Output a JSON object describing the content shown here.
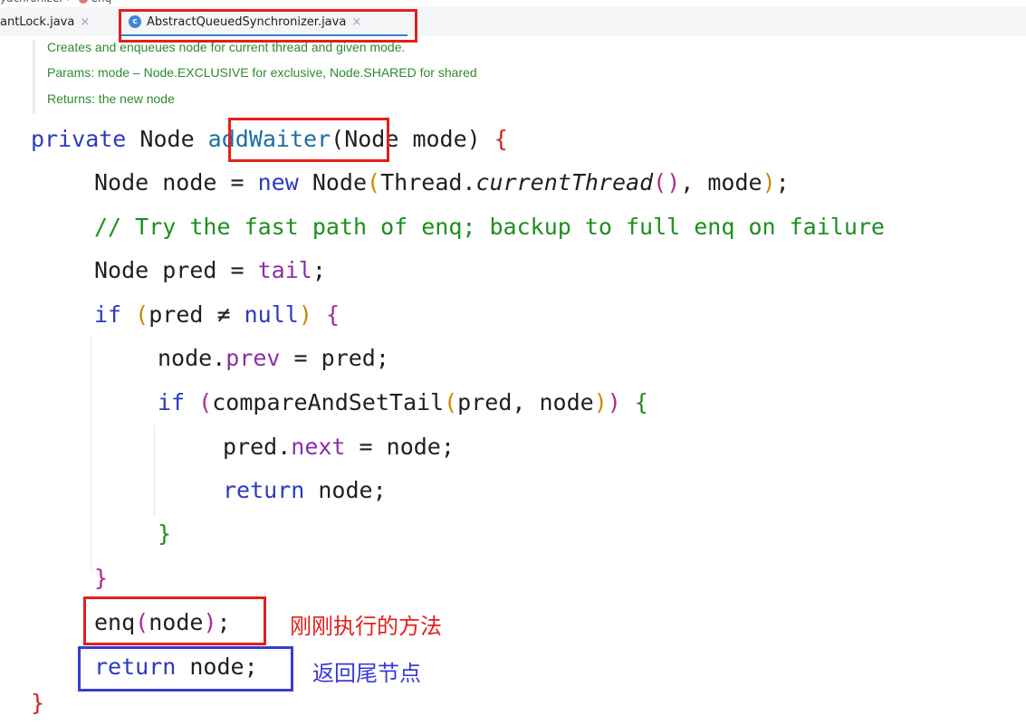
{
  "editor": {
    "tabs": [
      {
        "label": "antLock.java",
        "close": "×",
        "active": false
      },
      {
        "label": "AbstractQueuedSynchronizer.java",
        "close": "×",
        "active": true,
        "icon": "c-class-icon"
      }
    ]
  },
  "doc": {
    "line1": "Creates and enqueues node for current thread and given mode.",
    "line2": "Params: mode – Node.EXCLUSIVE for exclusive, Node.SHARED for shared",
    "line3": "Returns: the new node"
  },
  "code": {
    "l1": {
      "kw": "private",
      "t1": " Node ",
      "method": "addWaiter",
      "t2": "(Node mode) ",
      "brace": "{"
    },
    "l2": {
      "t1": "Node node = ",
      "kw": "new",
      "t2": " Node",
      "p1": "(",
      "t3": "Thread.",
      "it": "currentThread",
      "p2": "()",
      "t4": ", mode",
      "p3": ")",
      "t5": ";"
    },
    "l3": {
      "comment": "// Try the fast path of enq; backup to full enq on failure"
    },
    "l4": {
      "t1": "Node pred = ",
      "fld": "tail",
      "t2": ";"
    },
    "l5": {
      "kw": "if",
      "t1": " ",
      "p1": "(",
      "t2": "pred ≠ ",
      "kw2": "null",
      "p2": ")",
      "t3": " ",
      "brace": "{"
    },
    "l6": {
      "t1": "node.",
      "fld": "prev",
      "t2": " = pred;"
    },
    "l7": {
      "kw": "if",
      "t1": " ",
      "p1": "(",
      "t2": "compareAndSetTail",
      "p2": "(",
      "t3": "pred, node",
      "p3": ")",
      "p4": ")",
      "t4": " ",
      "brace": "{"
    },
    "l8": {
      "t1": "pred.",
      "fld": "next",
      "t2": " = node;"
    },
    "l9": {
      "kw": "return",
      "t1": " node;"
    },
    "l10": {
      "brace": "}"
    },
    "l11": {
      "brace": "}"
    },
    "l12": {
      "t1": "enq",
      "p1": "(",
      "t2": "node",
      "p2": ")",
      "t3": ";"
    },
    "l13": {
      "kw": "return",
      "t1": " node;"
    },
    "l14": {
      "brace": "}"
    }
  },
  "annotations": {
    "enq_note": "刚刚执行的方法",
    "return_note": "返回尾节点",
    "red": "#e2201c",
    "blue": "#3a3ad8"
  }
}
